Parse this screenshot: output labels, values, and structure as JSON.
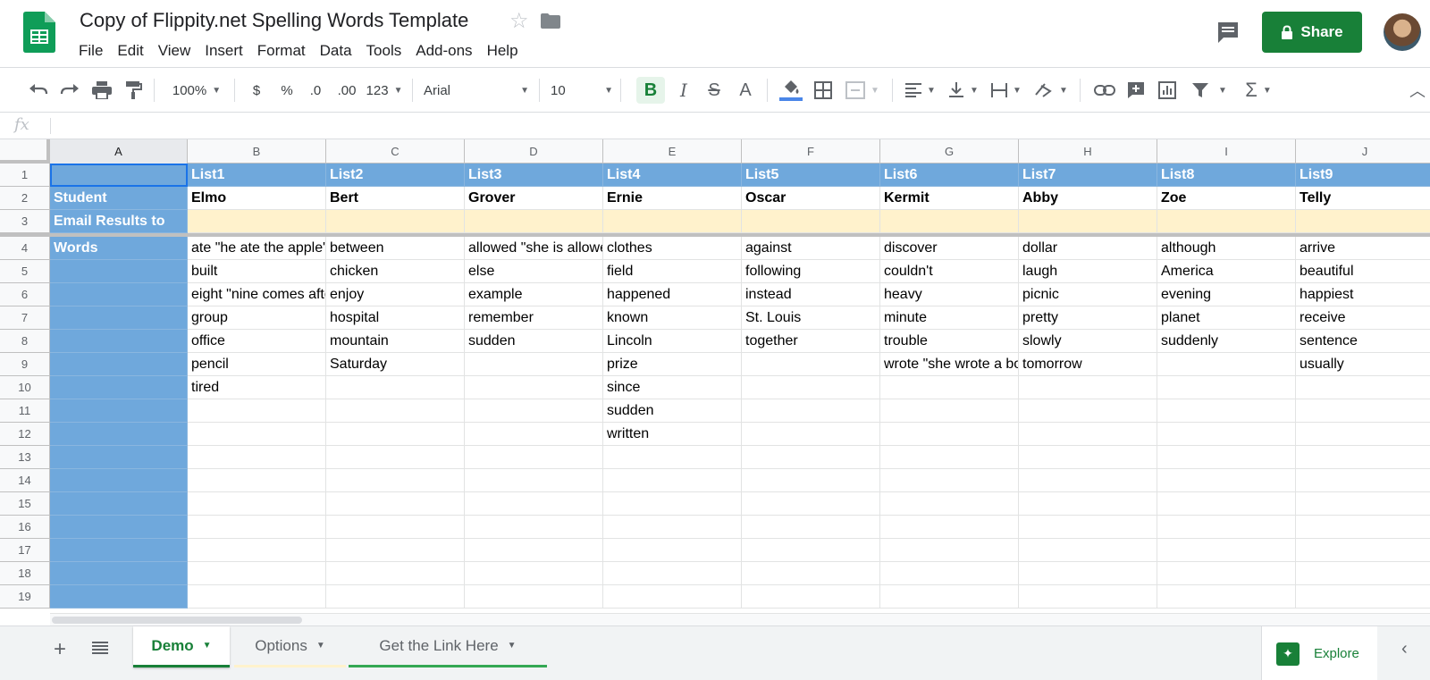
{
  "header": {
    "title": "Copy of Flippity.net Spelling Words Template",
    "menu": [
      "File",
      "Edit",
      "View",
      "Insert",
      "Format",
      "Data",
      "Tools",
      "Add-ons",
      "Help"
    ],
    "share_label": "Share"
  },
  "toolbar": {
    "zoom": "100%",
    "currency": "$",
    "percent": "%",
    "decrease_decimal": ".0",
    "increase_decimal": ".00",
    "more_formats": "123",
    "font": "Arial",
    "font_size": "10",
    "bold": "B",
    "italic": "I",
    "strikethrough": "S",
    "text_color": "A",
    "functions": "Σ"
  },
  "formula_bar": {
    "fx": "fx"
  },
  "grid": {
    "columns": [
      "A",
      "B",
      "C",
      "D",
      "E",
      "F",
      "G",
      "H",
      "I",
      "J"
    ],
    "row_numbers": [
      "1",
      "2",
      "3",
      "4",
      "5",
      "6",
      "7",
      "8",
      "9",
      "10",
      "11",
      "12",
      "13",
      "14",
      "15",
      "16",
      "17",
      "18",
      "19"
    ],
    "rows": [
      [
        "",
        "List1",
        "List2",
        "List3",
        "List4",
        "List5",
        "List6",
        "List7",
        "List8",
        "List9"
      ],
      [
        "Student",
        "Elmo",
        "Bert",
        "Grover",
        "Ernie",
        "Oscar",
        "Kermit",
        "Abby",
        "Zoe",
        "Telly"
      ],
      [
        "Email Results to",
        "",
        "",
        "",
        "",
        "",
        "",
        "",
        "",
        ""
      ],
      [
        "Words",
        "ate \"he ate the apple\"",
        "between",
        "allowed \"she is allowed\"",
        "clothes",
        "against",
        "discover",
        "dollar",
        "although",
        "arrive"
      ],
      [
        "",
        "built",
        "chicken",
        "else",
        "field",
        "following",
        "couldn't",
        "laugh",
        "America",
        "beautiful"
      ],
      [
        "",
        "eight \"nine comes after\"",
        "enjoy",
        "example",
        "happened",
        "instead",
        "heavy",
        "picnic",
        "evening",
        "happiest"
      ],
      [
        "",
        "group",
        "hospital",
        "remember",
        "known",
        "St. Louis",
        "minute",
        "pretty",
        "planet",
        "receive"
      ],
      [
        "",
        "office",
        "mountain",
        "sudden",
        "Lincoln",
        "together",
        "trouble",
        "slowly",
        "suddenly",
        "sentence"
      ],
      [
        "",
        "pencil",
        "Saturday",
        "",
        "prize",
        "",
        "wrote \"she wrote a book\"",
        "tomorrow",
        "",
        "usually"
      ],
      [
        "",
        "tired",
        "",
        "",
        "since",
        "",
        "",
        "",
        "",
        ""
      ],
      [
        "",
        "",
        "",
        "",
        "sudden",
        "",
        "",
        "",
        "",
        ""
      ],
      [
        "",
        "",
        "",
        "",
        "written",
        "",
        "",
        "",
        "",
        ""
      ],
      [
        "",
        "",
        "",
        "",
        "",
        "",
        "",
        "",
        "",
        ""
      ],
      [
        "",
        "",
        "",
        "",
        "",
        "",
        "",
        "",
        "",
        ""
      ],
      [
        "",
        "",
        "",
        "",
        "",
        "",
        "",
        "",
        "",
        ""
      ],
      [
        "",
        "",
        "",
        "",
        "",
        "",
        "",
        "",
        "",
        ""
      ],
      [
        "",
        "",
        "",
        "",
        "",
        "",
        "",
        "",
        "",
        ""
      ],
      [
        "",
        "",
        "",
        "",
        "",
        "",
        "",
        "",
        "",
        ""
      ],
      [
        "",
        "",
        "",
        "",
        "",
        "",
        "",
        "",
        "",
        ""
      ]
    ]
  },
  "sheet_tabs": [
    {
      "label": "Demo",
      "active": true
    },
    {
      "label": "Options",
      "active": false
    },
    {
      "label": "Get the Link Here",
      "active": false
    }
  ],
  "explore_label": "Explore",
  "colors": {
    "brand_green": "#188038",
    "header_blue": "#6fa8dc",
    "email_yellow": "#fff2cc",
    "selection_blue": "#1a73e8"
  }
}
